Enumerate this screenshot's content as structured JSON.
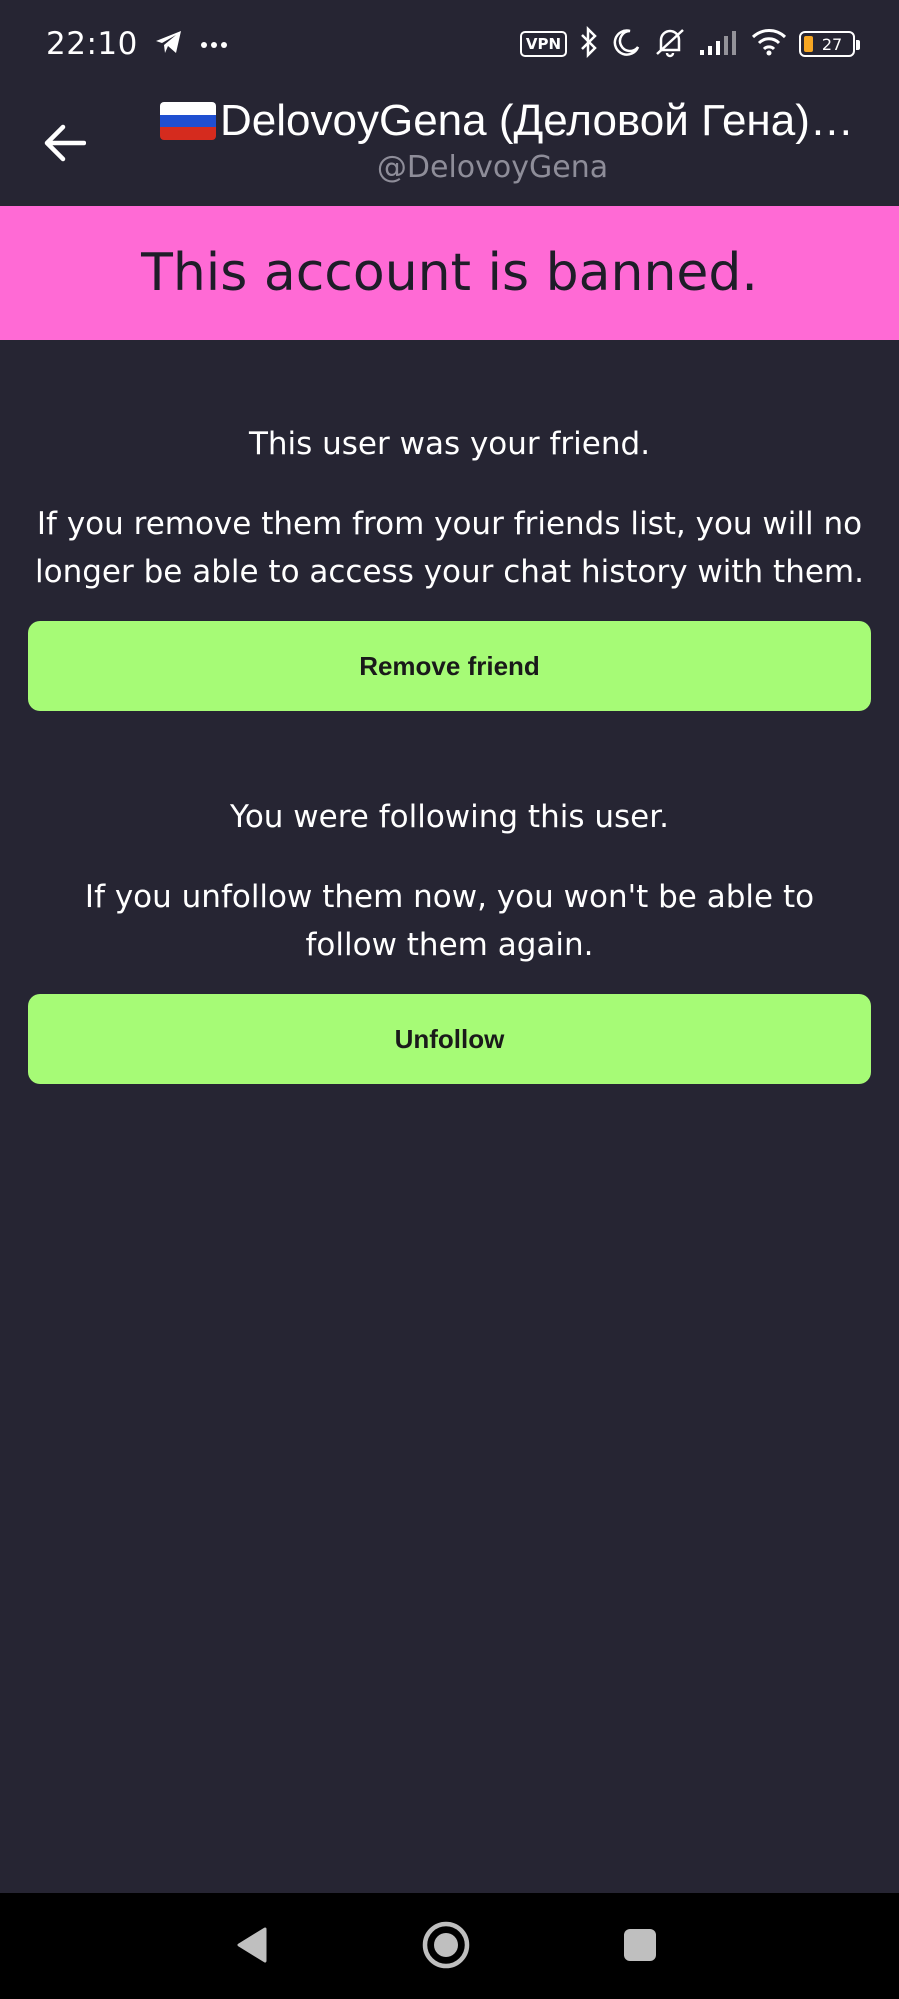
{
  "status_bar": {
    "time": "22:10",
    "vpn_label": "VPN",
    "battery_level": "27",
    "icons": [
      "telegram-icon",
      "more-dots-icon",
      "vpn-icon",
      "bluetooth-icon",
      "moon-icon",
      "mute-icon",
      "signal-icon",
      "wifi-icon",
      "battery-icon"
    ]
  },
  "header": {
    "title": "DelovoyGena (Деловой Гена)…",
    "username": "@DelovoyGena",
    "back_icon": "arrow-left-icon",
    "flag_icon": "russia-flag-icon"
  },
  "banner": {
    "text": "This account is banned.",
    "color": "#ff6ad5"
  },
  "friend_section": {
    "title": "This user was your friend.",
    "description": "If you remove them from your friends list, you will no longer be able to access your chat history with them.",
    "button_label": "Remove friend"
  },
  "follow_section": {
    "title": "You were following this user.",
    "description": "If you unfollow them now, you won't be able to follow them again.",
    "button_label": "Unfollow"
  },
  "colors": {
    "background": "#262533",
    "button": "#a6fb76",
    "muted_text": "#8e8d99"
  },
  "nav_bar": {
    "icons": [
      "nav-back-icon",
      "nav-home-icon",
      "nav-recents-icon"
    ]
  }
}
